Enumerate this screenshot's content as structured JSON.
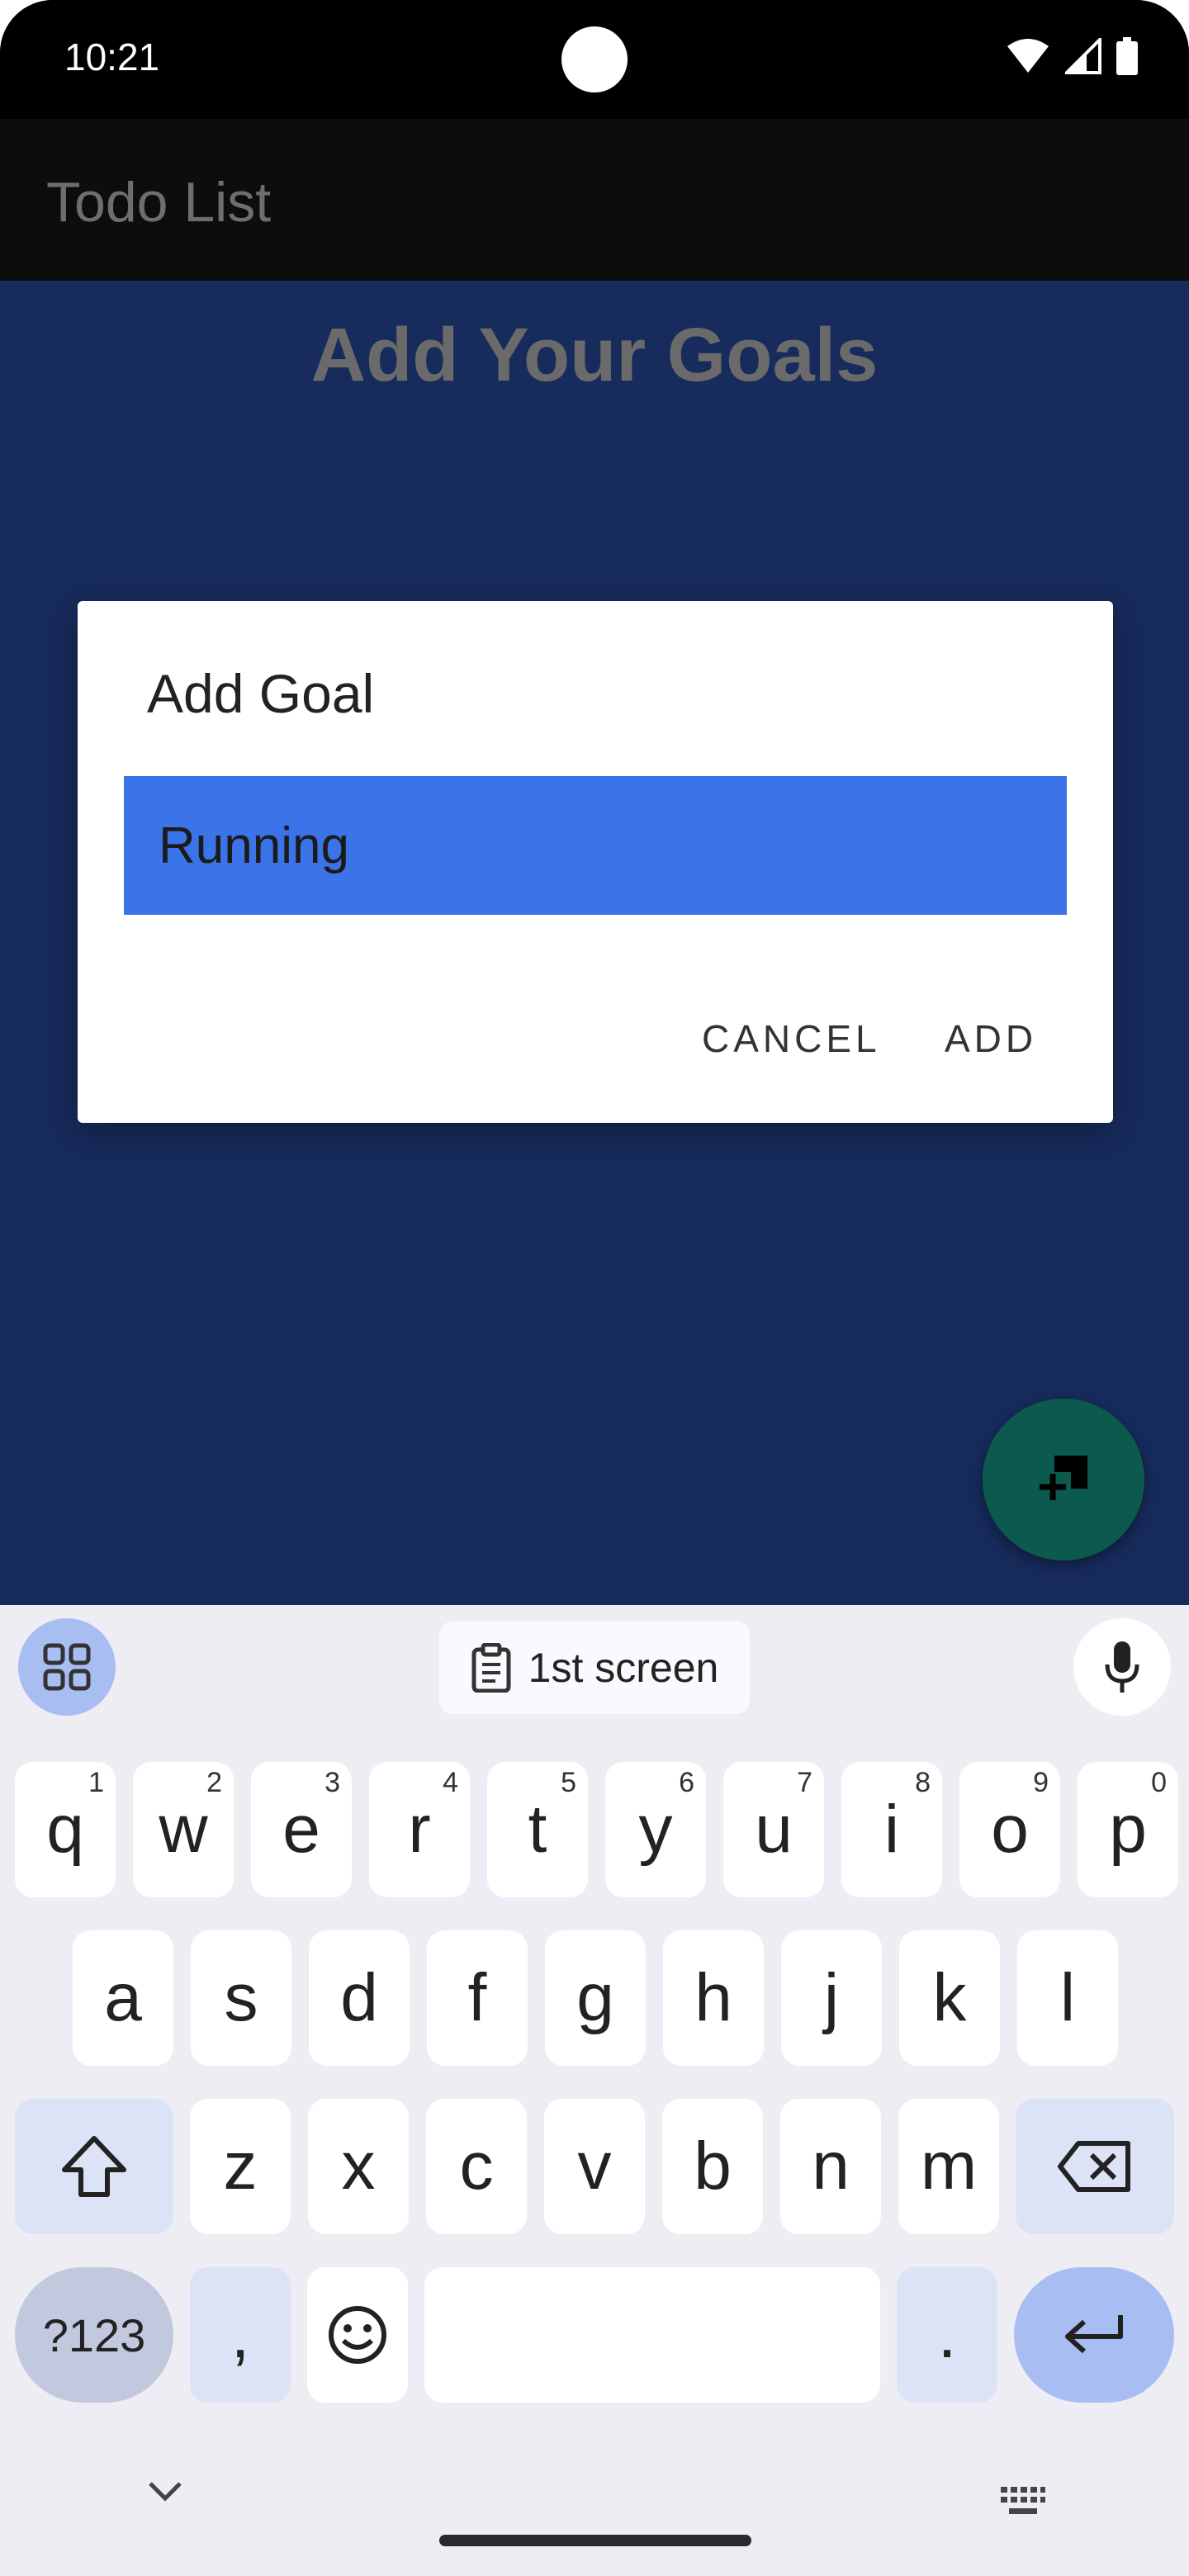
{
  "status_bar": {
    "time": "10:21"
  },
  "app_bar": {
    "title": "Todo List"
  },
  "main": {
    "heading": "Add Your Goals"
  },
  "dialog": {
    "title": "Add Goal",
    "input_value": "Running",
    "cancel_label": "CANCEL",
    "add_label": "ADD"
  },
  "fab": {
    "icon": "add-note-icon"
  },
  "keyboard": {
    "suggestion": "1st screen",
    "row1": [
      {
        "key": "q",
        "hint": "1"
      },
      {
        "key": "w",
        "hint": "2"
      },
      {
        "key": "e",
        "hint": "3"
      },
      {
        "key": "r",
        "hint": "4"
      },
      {
        "key": "t",
        "hint": "5"
      },
      {
        "key": "y",
        "hint": "6"
      },
      {
        "key": "u",
        "hint": "7"
      },
      {
        "key": "i",
        "hint": "8"
      },
      {
        "key": "o",
        "hint": "9"
      },
      {
        "key": "p",
        "hint": "0"
      }
    ],
    "row2": [
      "a",
      "s",
      "d",
      "f",
      "g",
      "h",
      "j",
      "k",
      "l"
    ],
    "row3": [
      "z",
      "x",
      "c",
      "v",
      "b",
      "n",
      "m"
    ],
    "sym_label": "?123",
    "comma": ",",
    "period": "."
  },
  "colors": {
    "content_bg": "#172b5c",
    "input_bg": "#3b73e8",
    "fab_bg": "#0b5a4d",
    "keyboard_bg": "#eeedf3"
  }
}
